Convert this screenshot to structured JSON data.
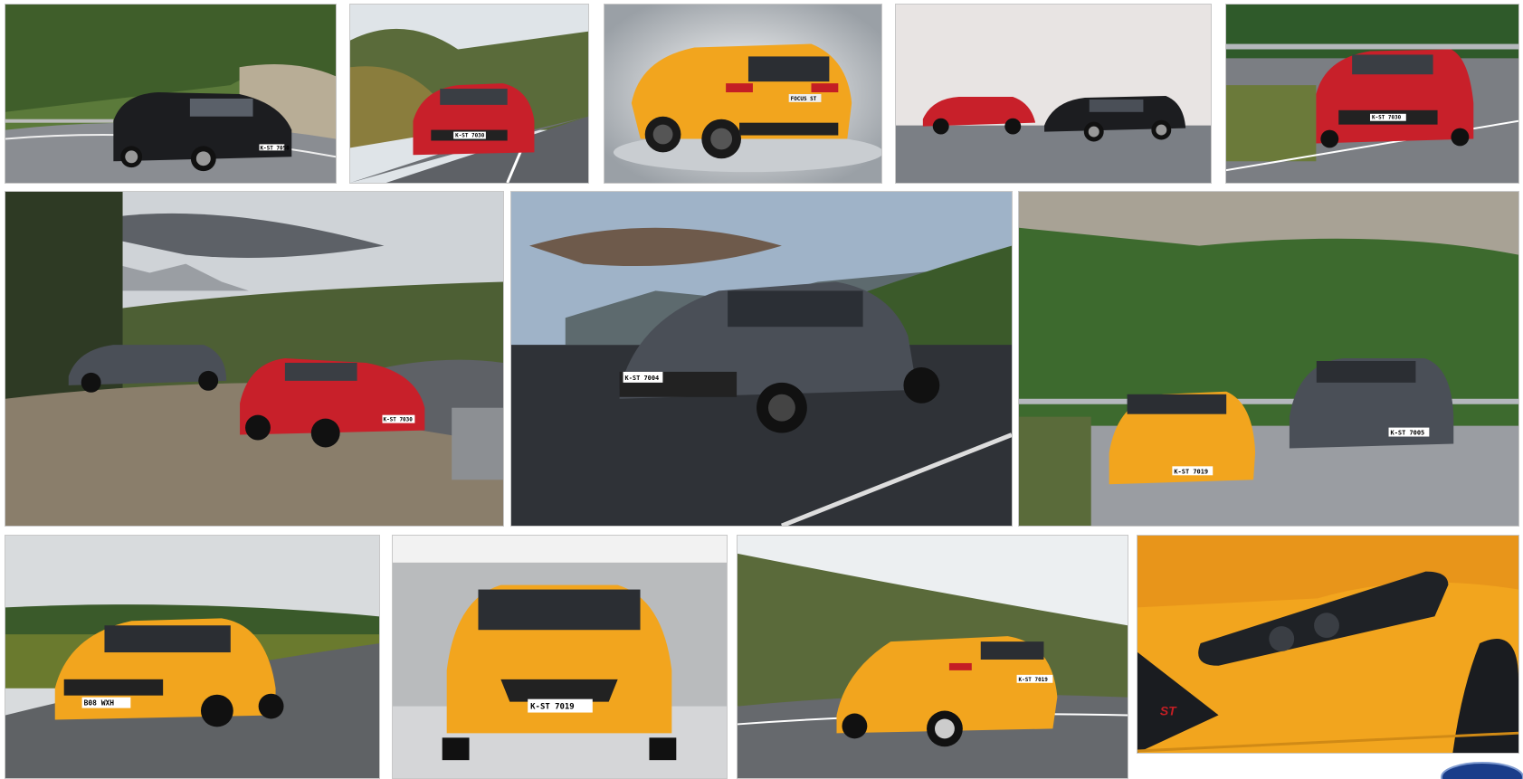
{
  "gallery": {
    "images": [
      {
        "alt": "Ford Focus ST estate, black, on mountain road",
        "plate": "K-ST 7050"
      },
      {
        "alt": "Ford Focus ST red, cornering",
        "plate": "K-ST 7030"
      },
      {
        "alt": "Ford Focus ST yellow, rear view studio",
        "plate": "FOCUS ST"
      },
      {
        "alt": "Ford Focus ST red and black side by side",
        "plate": ""
      },
      {
        "alt": "Ford Focus ST red, front, road",
        "plate": "K-ST 7030"
      },
      {
        "alt": "Ford Focus ST estate grey and red hatch, mountains",
        "plate": "K-ST 7030"
      },
      {
        "alt": "Ford Focus ST estate grey, driving",
        "plate": "K-ST 7004"
      },
      {
        "alt": "Ford Focus ST yellow and grey estate, hill road",
        "plates": [
          "K-ST 7019",
          "K-ST 7005"
        ]
      },
      {
        "alt": "Ford Focus ST yellow, countryside",
        "plate": "B08 WXH"
      },
      {
        "alt": "Ford Focus ST yellow, front, concrete wall",
        "plate": "K-ST 7019"
      },
      {
        "alt": "Ford Focus ST yellow, rear, hill road",
        "plate": "K-ST 7019"
      },
      {
        "alt": "Ford Focus ST yellow, headlight detail",
        "badge": "ST"
      }
    ]
  },
  "brand": {
    "logo": "ford-logo"
  },
  "colors": {
    "yellow": "#f2a51e",
    "red": "#c8202a",
    "grey": "#4a4f57",
    "black": "#1c1d20"
  }
}
